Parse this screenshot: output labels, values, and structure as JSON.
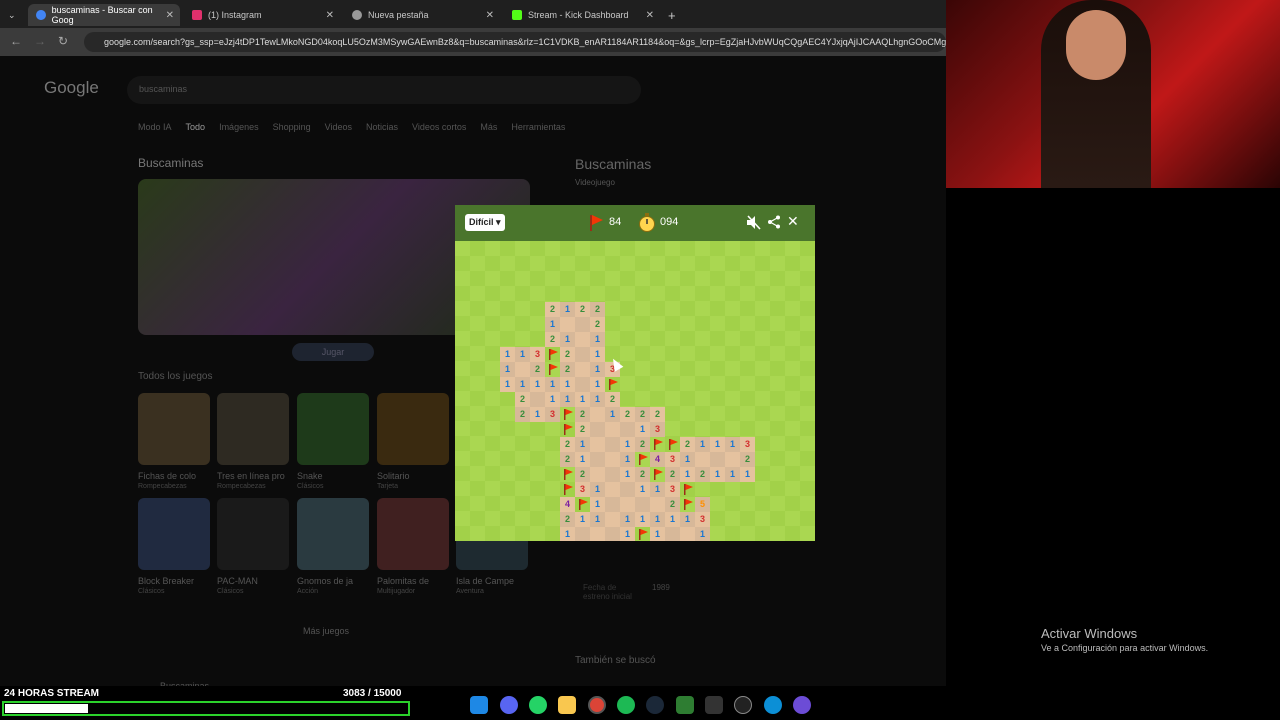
{
  "browser": {
    "tabs": [
      {
        "title": "buscaminas - Buscar con Goog",
        "active": true
      },
      {
        "title": "(1) Instagram",
        "active": false
      },
      {
        "title": "Nueva pestaña",
        "active": false
      },
      {
        "title": "Stream - Kick Dashboard",
        "active": false
      }
    ],
    "url": "google.com/search?gs_ssp=eJzj4tDP1TewLMkoNGD04koqLU5OzM3MSywGAEwnBz8&q=buscaminas&rlz=1C1VDKB_enAR1184AR1184&oq=&gs_lcrp=EgZjaHJvbWUqCQgAEC4YJxjqAjIJCAAQLhgnGOoCMg"
  },
  "google": {
    "logo": "Google",
    "query": "buscaminas",
    "tabs": [
      "Modo IA",
      "Todo",
      "Imágenes",
      "Shopping",
      "Videos",
      "Noticias",
      "Videos cortos",
      "Más",
      "Herramientas"
    ],
    "card_title": "Buscaminas",
    "play_button": "Jugar",
    "all_games": "Todos los juegos",
    "games": [
      {
        "name": "Fichas de colo",
        "cat": "Rompecabezas"
      },
      {
        "name": "Tres en línea pro",
        "cat": "Rompecabezas"
      },
      {
        "name": "Snake",
        "cat": "Clásicos"
      },
      {
        "name": "Solitario",
        "cat": "Tarjeta"
      },
      {
        "name": "Block Breaker",
        "cat": "Clásicos"
      },
      {
        "name": "PAC-MAN",
        "cat": "Clásicos"
      },
      {
        "name": "Gnomos de ja",
        "cat": "Acción"
      },
      {
        "name": "Palomitas de",
        "cat": "Multijugador"
      },
      {
        "name": "Isla de Campe",
        "cat": "Aventura"
      }
    ],
    "more_games": "Más juegos",
    "kp_title": "Buscaminas",
    "kp_subtitle": "Videojuego",
    "kp_date_label": "Fecha de estreno inicial",
    "kp_date_value": "1989",
    "also_searched": "También se buscó",
    "bottom_item": "Buscaminas"
  },
  "game": {
    "difficulty": "Difícil",
    "flags_left": "84",
    "timer": "094",
    "colors": {
      "header": "#4a752c",
      "grass_light": "#aad751",
      "grass_dark": "#a2d149",
      "dirt": "#e5c29f"
    },
    "revealed": [
      {
        "r": 0,
        "c": 6,
        "v": "2"
      },
      {
        "r": 0,
        "c": 7,
        "v": "1"
      },
      {
        "r": 0,
        "c": 8,
        "v": "2"
      },
      {
        "r": 0,
        "c": 9,
        "v": "2"
      },
      {
        "r": 1,
        "c": 6,
        "v": "1"
      },
      {
        "r": 1,
        "c": 7,
        "v": ""
      },
      {
        "r": 1,
        "c": 8,
        "v": ""
      },
      {
        "r": 1,
        "c": 9,
        "v": "2"
      },
      {
        "r": 2,
        "c": 6,
        "v": "2"
      },
      {
        "r": 2,
        "c": 7,
        "v": "1"
      },
      {
        "r": 2,
        "c": 8,
        "v": ""
      },
      {
        "r": 2,
        "c": 9,
        "v": "1"
      },
      {
        "r": 3,
        "c": 3,
        "v": "1"
      },
      {
        "r": 3,
        "c": 4,
        "v": "1"
      },
      {
        "r": 3,
        "c": 5,
        "v": "3"
      },
      {
        "r": 3,
        "c": 6,
        "v": "F"
      },
      {
        "r": 3,
        "c": 7,
        "v": "2"
      },
      {
        "r": 3,
        "c": 8,
        "v": ""
      },
      {
        "r": 3,
        "c": 9,
        "v": "1"
      },
      {
        "r": 4,
        "c": 3,
        "v": "1"
      },
      {
        "r": 4,
        "c": 4,
        "v": ""
      },
      {
        "r": 4,
        "c": 5,
        "v": "2"
      },
      {
        "r": 4,
        "c": 6,
        "v": "F"
      },
      {
        "r": 4,
        "c": 7,
        "v": "2"
      },
      {
        "r": 4,
        "c": 8,
        "v": ""
      },
      {
        "r": 4,
        "c": 9,
        "v": "1"
      },
      {
        "r": 4,
        "c": 10,
        "v": "3"
      },
      {
        "r": 5,
        "c": 3,
        "v": "1"
      },
      {
        "r": 5,
        "c": 4,
        "v": "1"
      },
      {
        "r": 5,
        "c": 5,
        "v": "1"
      },
      {
        "r": 5,
        "c": 6,
        "v": "1"
      },
      {
        "r": 5,
        "c": 7,
        "v": "1"
      },
      {
        "r": 5,
        "c": 8,
        "v": ""
      },
      {
        "r": 5,
        "c": 9,
        "v": "1"
      },
      {
        "r": 5,
        "c": 10,
        "v": "F"
      },
      {
        "r": 6,
        "c": 4,
        "v": "2"
      },
      {
        "r": 6,
        "c": 5,
        "v": ""
      },
      {
        "r": 6,
        "c": 6,
        "v": "1"
      },
      {
        "r": 6,
        "c": 7,
        "v": "1"
      },
      {
        "r": 6,
        "c": 8,
        "v": "1"
      },
      {
        "r": 6,
        "c": 9,
        "v": "1"
      },
      {
        "r": 6,
        "c": 10,
        "v": "2"
      },
      {
        "r": 7,
        "c": 4,
        "v": "2"
      },
      {
        "r": 7,
        "c": 5,
        "v": "1"
      },
      {
        "r": 7,
        "c": 6,
        "v": "3"
      },
      {
        "r": 7,
        "c": 7,
        "v": "F"
      },
      {
        "r": 7,
        "c": 8,
        "v": "2"
      },
      {
        "r": 7,
        "c": 9,
        "v": ""
      },
      {
        "r": 7,
        "c": 10,
        "v": "1"
      },
      {
        "r": 7,
        "c": 11,
        "v": "2"
      },
      {
        "r": 7,
        "c": 12,
        "v": "2"
      },
      {
        "r": 7,
        "c": 13,
        "v": "2"
      },
      {
        "r": 8,
        "c": 7,
        "v": "F"
      },
      {
        "r": 8,
        "c": 8,
        "v": "2"
      },
      {
        "r": 8,
        "c": 9,
        "v": ""
      },
      {
        "r": 8,
        "c": 10,
        "v": ""
      },
      {
        "r": 8,
        "c": 11,
        "v": ""
      },
      {
        "r": 8,
        "c": 12,
        "v": "1"
      },
      {
        "r": 8,
        "c": 13,
        "v": "3"
      },
      {
        "r": 9,
        "c": 7,
        "v": "2"
      },
      {
        "r": 9,
        "c": 8,
        "v": "1"
      },
      {
        "r": 9,
        "c": 9,
        "v": ""
      },
      {
        "r": 9,
        "c": 10,
        "v": ""
      },
      {
        "r": 9,
        "c": 11,
        "v": "1"
      },
      {
        "r": 9,
        "c": 12,
        "v": "2"
      },
      {
        "r": 9,
        "c": 13,
        "v": "F"
      },
      {
        "r": 9,
        "c": 14,
        "v": "F"
      },
      {
        "r": 9,
        "c": 15,
        "v": "2"
      },
      {
        "r": 9,
        "c": 16,
        "v": "1"
      },
      {
        "r": 9,
        "c": 17,
        "v": "1"
      },
      {
        "r": 9,
        "c": 18,
        "v": "1"
      },
      {
        "r": 9,
        "c": 19,
        "v": "3"
      },
      {
        "r": 10,
        "c": 7,
        "v": "2"
      },
      {
        "r": 10,
        "c": 8,
        "v": "1"
      },
      {
        "r": 10,
        "c": 9,
        "v": ""
      },
      {
        "r": 10,
        "c": 10,
        "v": ""
      },
      {
        "r": 10,
        "c": 11,
        "v": "1"
      },
      {
        "r": 10,
        "c": 12,
        "v": "F"
      },
      {
        "r": 10,
        "c": 13,
        "v": "4"
      },
      {
        "r": 10,
        "c": 14,
        "v": "3"
      },
      {
        "r": 10,
        "c": 15,
        "v": "1"
      },
      {
        "r": 10,
        "c": 16,
        "v": ""
      },
      {
        "r": 10,
        "c": 17,
        "v": ""
      },
      {
        "r": 10,
        "c": 18,
        "v": ""
      },
      {
        "r": 10,
        "c": 19,
        "v": "2"
      },
      {
        "r": 11,
        "c": 7,
        "v": "F"
      },
      {
        "r": 11,
        "c": 8,
        "v": "2"
      },
      {
        "r": 11,
        "c": 9,
        "v": ""
      },
      {
        "r": 11,
        "c": 10,
        "v": ""
      },
      {
        "r": 11,
        "c": 11,
        "v": "1"
      },
      {
        "r": 11,
        "c": 12,
        "v": "2"
      },
      {
        "r": 11,
        "c": 13,
        "v": "F"
      },
      {
        "r": 11,
        "c": 14,
        "v": "2"
      },
      {
        "r": 11,
        "c": 15,
        "v": "1"
      },
      {
        "r": 11,
        "c": 16,
        "v": "2"
      },
      {
        "r": 11,
        "c": 17,
        "v": "1"
      },
      {
        "r": 11,
        "c": 18,
        "v": "1"
      },
      {
        "r": 11,
        "c": 19,
        "v": "1"
      },
      {
        "r": 12,
        "c": 7,
        "v": "F"
      },
      {
        "r": 12,
        "c": 8,
        "v": "3"
      },
      {
        "r": 12,
        "c": 9,
        "v": "1"
      },
      {
        "r": 12,
        "c": 10,
        "v": ""
      },
      {
        "r": 12,
        "c": 11,
        "v": ""
      },
      {
        "r": 12,
        "c": 12,
        "v": "1"
      },
      {
        "r": 12,
        "c": 13,
        "v": "1"
      },
      {
        "r": 12,
        "c": 14,
        "v": "3"
      },
      {
        "r": 12,
        "c": 15,
        "v": "F"
      },
      {
        "r": 13,
        "c": 7,
        "v": "4"
      },
      {
        "r": 13,
        "c": 8,
        "v": "F"
      },
      {
        "r": 13,
        "c": 9,
        "v": "1"
      },
      {
        "r": 13,
        "c": 10,
        "v": ""
      },
      {
        "r": 13,
        "c": 11,
        "v": ""
      },
      {
        "r": 13,
        "c": 12,
        "v": ""
      },
      {
        "r": 13,
        "c": 13,
        "v": ""
      },
      {
        "r": 13,
        "c": 14,
        "v": "2"
      },
      {
        "r": 13,
        "c": 15,
        "v": "F"
      },
      {
        "r": 13,
        "c": 16,
        "v": "5"
      },
      {
        "r": 14,
        "c": 7,
        "v": "2"
      },
      {
        "r": 14,
        "c": 8,
        "v": "1"
      },
      {
        "r": 14,
        "c": 9,
        "v": "1"
      },
      {
        "r": 14,
        "c": 10,
        "v": ""
      },
      {
        "r": 14,
        "c": 11,
        "v": "1"
      },
      {
        "r": 14,
        "c": 12,
        "v": "1"
      },
      {
        "r": 14,
        "c": 13,
        "v": "1"
      },
      {
        "r": 14,
        "c": 14,
        "v": "1"
      },
      {
        "r": 14,
        "c": 15,
        "v": "1"
      },
      {
        "r": 14,
        "c": 16,
        "v": "3"
      },
      {
        "r": 15,
        "c": 7,
        "v": "1"
      },
      {
        "r": 15,
        "c": 8,
        "v": ""
      },
      {
        "r": 15,
        "c": 9,
        "v": ""
      },
      {
        "r": 15,
        "c": 10,
        "v": ""
      },
      {
        "r": 15,
        "c": 11,
        "v": "1"
      },
      {
        "r": 15,
        "c": 12,
        "v": "F"
      },
      {
        "r": 15,
        "c": 13,
        "v": "1"
      },
      {
        "r": 15,
        "c": 14,
        "v": ""
      },
      {
        "r": 15,
        "c": 15,
        "v": ""
      },
      {
        "r": 15,
        "c": 16,
        "v": "1"
      }
    ]
  },
  "windows": {
    "activate_title": "Activar Windows",
    "activate_sub": "Ve a Configuración para activar Windows."
  },
  "stream": {
    "label": "24 HORAS STREAM",
    "count": "3083  / 15000",
    "progress": 0.2055
  }
}
